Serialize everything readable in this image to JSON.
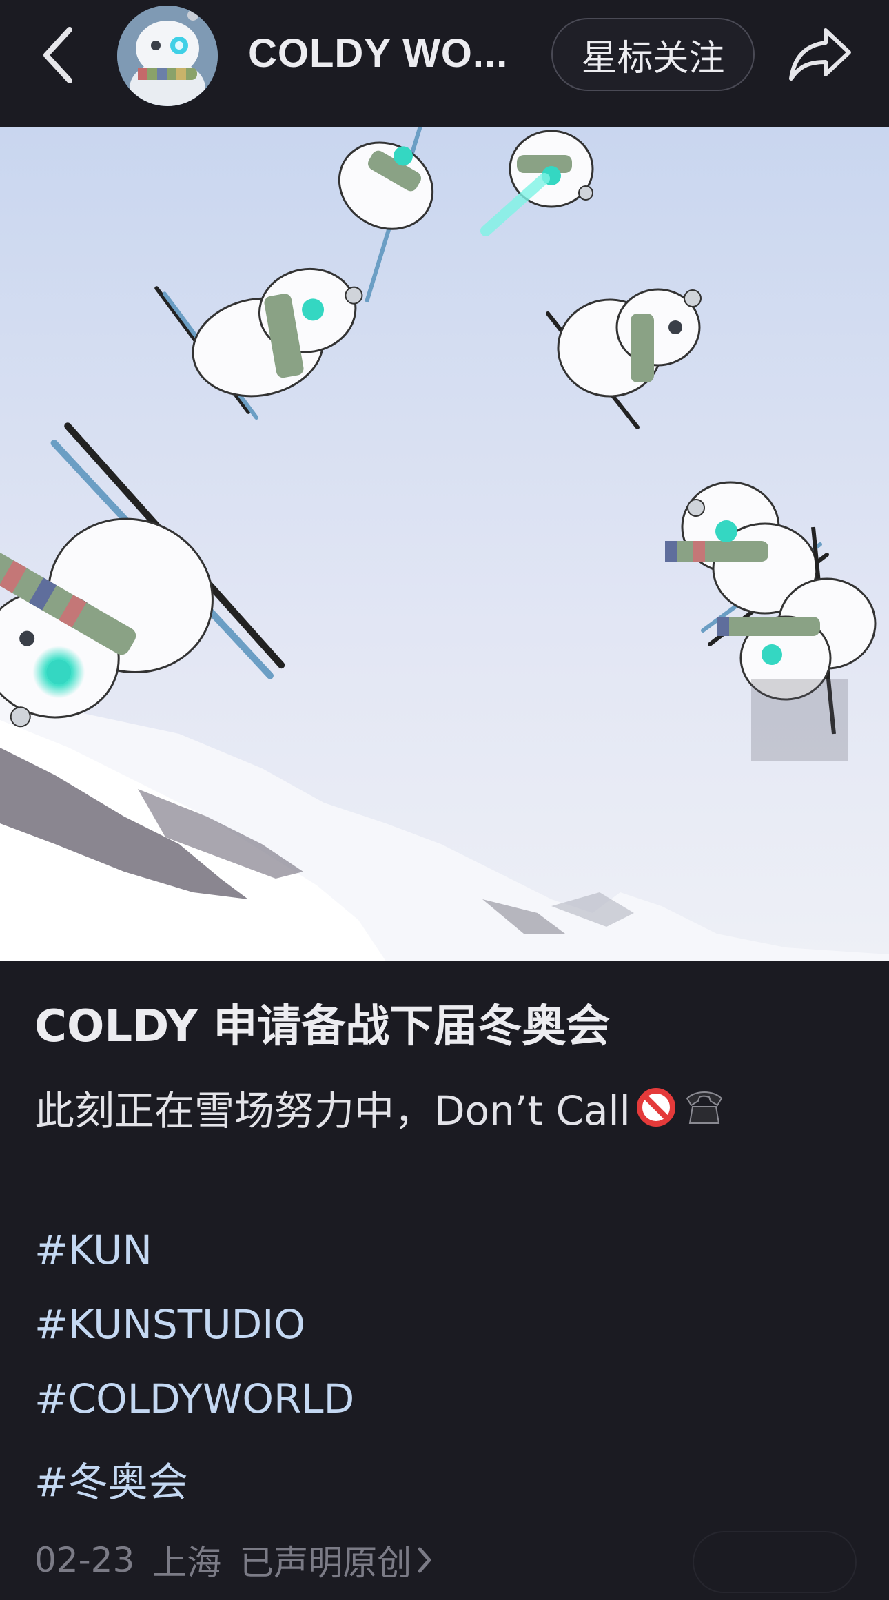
{
  "header": {
    "account_name": "COLDY WO...",
    "follow_label": "星标关注",
    "back_icon": "chevron-left-icon",
    "share_icon": "share-arrow-icon"
  },
  "image": {
    "description_icon": "skiing-snowmen-illustration"
  },
  "post": {
    "title": "COLDY 申请备战下届冬奥会",
    "description": "此刻正在雪场努力中，Don’t Call",
    "hashtags": [
      "#KUN",
      "#KUNSTUDIO",
      "#COLDYWORLD",
      "#冬奥会"
    ]
  },
  "meta": {
    "date": "02-23",
    "location": "上海",
    "original_label": "已声明原创"
  },
  "colors": {
    "background": "#1b1b22",
    "hashtag": "#c4d8f2",
    "meta": "#7b7b86"
  }
}
